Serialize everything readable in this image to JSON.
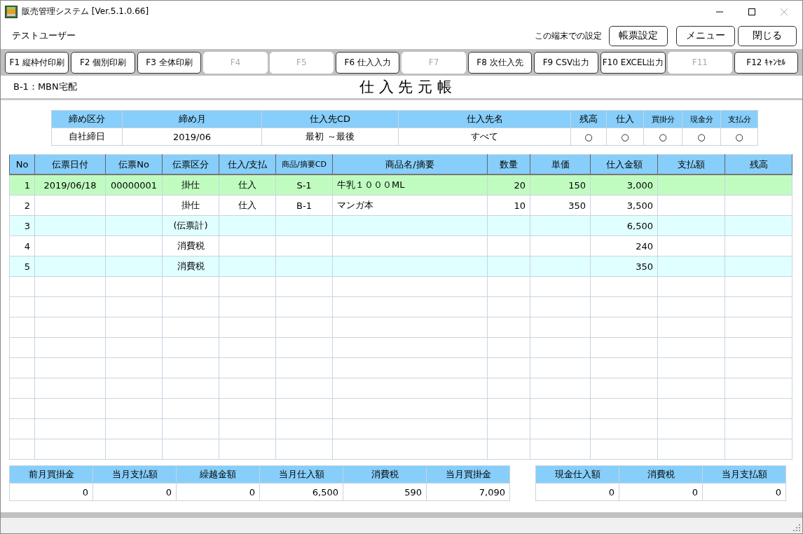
{
  "window": {
    "title": "販売管理システム [Ver.5.1.0.66]"
  },
  "user": "テストユーザー",
  "settings_label": "この端末での設定",
  "top_buttons": [
    "帳票設定",
    "メニュー",
    "閉じる"
  ],
  "function_keys": [
    {
      "label": "F1 縦枠付印刷",
      "disabled": false
    },
    {
      "label": "F2 個別印刷",
      "disabled": false
    },
    {
      "label": "F3 全体印刷",
      "disabled": false
    },
    {
      "label": "F4",
      "disabled": true
    },
    {
      "label": "F5",
      "disabled": true
    },
    {
      "label": "F6 仕入入力",
      "disabled": false
    },
    {
      "label": "F7",
      "disabled": true
    },
    {
      "label": "F8 次仕入先",
      "disabled": false
    },
    {
      "label": "F9 CSV出力",
      "disabled": false
    },
    {
      "label": "F10 EXCEL出力",
      "disabled": false
    },
    {
      "label": "F11",
      "disabled": true
    },
    {
      "label": "F12 ｷｬﾝｾﾙ",
      "disabled": false
    }
  ],
  "supplier": "B-1：MBN宅配",
  "page_title": "仕 入 先 元 帳",
  "criteria": {
    "columns": [
      "締め区分",
      "締め月",
      "仕入先CD",
      "仕入先名",
      "残高",
      "仕入",
      "買掛分",
      "現金分",
      "支払分"
    ],
    "values": [
      "自社締日",
      "2019/06",
      "最初 ～最後",
      "すべて",
      "○",
      "○",
      "○",
      "○",
      "○"
    ]
  },
  "table": {
    "columns": [
      "No",
      "伝票日付",
      "伝票No",
      "伝票区分",
      "仕入/支払",
      "商品/摘要CD",
      "商品名/摘要",
      "数量",
      "単価",
      "仕入金額",
      "支払額",
      "残高"
    ],
    "rows": [
      {
        "selected": true,
        "cells": [
          "1",
          "2019/06/18",
          "00000001",
          "掛仕",
          "仕入",
          "S-1",
          "牛乳１０００ML",
          "20",
          "150",
          "3,000",
          "",
          ""
        ]
      },
      {
        "selected": false,
        "cells": [
          "2",
          "",
          "",
          "掛仕",
          "仕入",
          "B-1",
          "マンガ本",
          "10",
          "350",
          "3,500",
          "",
          ""
        ]
      },
      {
        "selected": false,
        "cells": [
          "3",
          "",
          "",
          "(伝票計)",
          "",
          "",
          "",
          "",
          "",
          "6,500",
          "",
          ""
        ]
      },
      {
        "selected": false,
        "cells": [
          "4",
          "",
          "",
          "消費税",
          "",
          "",
          "",
          "",
          "",
          "240",
          "",
          ""
        ]
      },
      {
        "selected": false,
        "cells": [
          "5",
          "",
          "",
          "消費税",
          "",
          "",
          "",
          "",
          "",
          "350",
          "",
          ""
        ]
      }
    ]
  },
  "summary": {
    "columns": [
      "前月買掛金",
      "当月支払額",
      "繰越金額",
      "当月仕入額",
      "消費税",
      "当月買掛金"
    ],
    "values": [
      "0",
      "0",
      "0",
      "6,500",
      "590",
      "7,090"
    ]
  },
  "cash_summary": {
    "columns": [
      "現金仕入額",
      "消費税",
      "当月支払額"
    ],
    "values": [
      "0",
      "0",
      "0"
    ]
  }
}
